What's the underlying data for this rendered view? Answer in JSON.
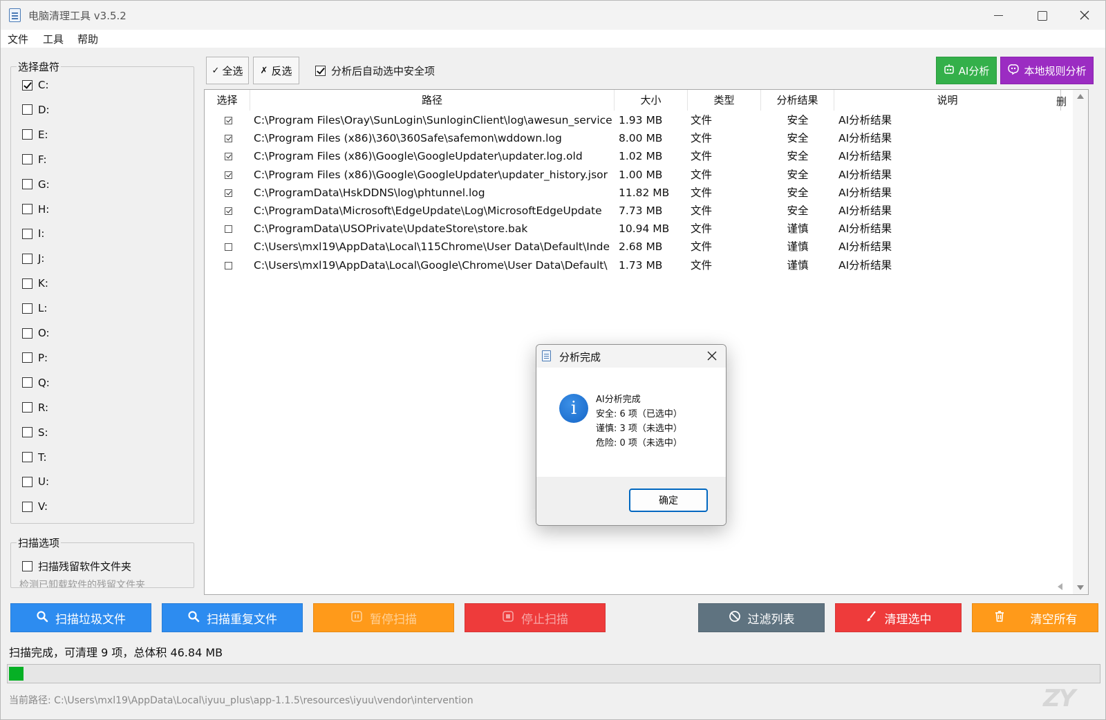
{
  "window": {
    "title": "电脑清理工具 v3.5.2"
  },
  "menu": [
    "文件",
    "工具",
    "帮助"
  ],
  "drive_panel": {
    "title": "选择盘符",
    "drives": [
      {
        "label": "C:",
        "checked": true
      },
      {
        "label": "D:",
        "checked": false
      },
      {
        "label": "E:",
        "checked": false
      },
      {
        "label": "F:",
        "checked": false
      },
      {
        "label": "G:",
        "checked": false
      },
      {
        "label": "H:",
        "checked": false
      },
      {
        "label": "I:",
        "checked": false
      },
      {
        "label": "J:",
        "checked": false
      },
      {
        "label": "K:",
        "checked": false
      },
      {
        "label": "L:",
        "checked": false
      },
      {
        "label": "O:",
        "checked": false
      },
      {
        "label": "P:",
        "checked": false
      },
      {
        "label": "Q:",
        "checked": false
      },
      {
        "label": "R:",
        "checked": false
      },
      {
        "label": "S:",
        "checked": false
      },
      {
        "label": "T:",
        "checked": false
      },
      {
        "label": "U:",
        "checked": false
      },
      {
        "label": "V:",
        "checked": false
      }
    ]
  },
  "scan_options": {
    "title": "扫描选项",
    "leftover_label": "扫描残留软件文件夹",
    "leftover_checked": false,
    "leftover_hint": "检测已卸载软件的残留文件夹"
  },
  "toolbar": {
    "select_all": "全选",
    "select_all_icon": "✓",
    "invert": "反选",
    "invert_icon": "✗",
    "auto_select_label": "分析后自动选中安全项",
    "auto_select_checked": true,
    "ai_button": "AI分析",
    "rule_button": "本地规则分析",
    "ai_color": "#34b04a",
    "rule_color": "#9b2cc2"
  },
  "table": {
    "columns": [
      "选择",
      "路径",
      "大小",
      "类型",
      "分析结果",
      "说明"
    ],
    "overflow_col": "删",
    "rows": [
      {
        "checked": true,
        "path": "C:\\Program Files\\Oray\\SunLogin\\SunloginClient\\log\\awesun_service",
        "size": "1.93 MB",
        "type": "文件",
        "result": "安全",
        "note": "AI分析结果"
      },
      {
        "checked": true,
        "path": "C:\\Program Files (x86)\\360\\360Safe\\safemon\\wddown.log",
        "size": "8.00 MB",
        "type": "文件",
        "result": "安全",
        "note": "AI分析结果"
      },
      {
        "checked": true,
        "path": "C:\\Program Files (x86)\\Google\\GoogleUpdater\\updater.log.old",
        "size": "1.02 MB",
        "type": "文件",
        "result": "安全",
        "note": "AI分析结果"
      },
      {
        "checked": true,
        "path": "C:\\Program Files (x86)\\Google\\GoogleUpdater\\updater_history.jsor",
        "size": "1.00 MB",
        "type": "文件",
        "result": "安全",
        "note": "AI分析结果"
      },
      {
        "checked": true,
        "path": "C:\\ProgramData\\HskDDNS\\log\\phtunnel.log",
        "size": "11.82 MB",
        "type": "文件",
        "result": "安全",
        "note": "AI分析结果"
      },
      {
        "checked": true,
        "path": "C:\\ProgramData\\Microsoft\\EdgeUpdate\\Log\\MicrosoftEdgeUpdate",
        "size": "7.73 MB",
        "type": "文件",
        "result": "安全",
        "note": "AI分析结果"
      },
      {
        "checked": false,
        "path": "C:\\ProgramData\\USOPrivate\\UpdateStore\\store.bak",
        "size": "10.94 MB",
        "type": "文件",
        "result": "谨慎",
        "note": "AI分析结果"
      },
      {
        "checked": false,
        "path": "C:\\Users\\mxl19\\AppData\\Local\\115Chrome\\User Data\\Default\\Inde",
        "size": "2.68 MB",
        "type": "文件",
        "result": "谨慎",
        "note": "AI分析结果"
      },
      {
        "checked": false,
        "path": "C:\\Users\\mxl19\\AppData\\Local\\Google\\Chrome\\User Data\\Default\\",
        "size": "1.73 MB",
        "type": "文件",
        "result": "谨慎",
        "note": "AI分析结果"
      }
    ]
  },
  "buttons": {
    "scan_junk": {
      "label": "扫描垃圾文件",
      "color": "#2d8cf0",
      "icon": "search-icon",
      "enabled": true
    },
    "scan_dup": {
      "label": "扫描重复文件",
      "color": "#2d8cf0",
      "icon": "search-icon",
      "enabled": true
    },
    "pause": {
      "label": "暂停扫描",
      "color": "#ff9a1a",
      "icon": "pause-icon",
      "enabled": false
    },
    "stop": {
      "label": "停止扫描",
      "color": "#ee3b3b",
      "icon": "stop-icon",
      "enabled": false
    },
    "filter": {
      "label": "过滤列表",
      "color": "#5f7380",
      "icon": "ban-icon",
      "enabled": true
    },
    "clean_selected": {
      "label": "清理选中",
      "color": "#ee3b3b",
      "icon": "brush-icon",
      "enabled": true
    },
    "clear_all": {
      "label": "清空所有",
      "color": "#ff9a1a",
      "icon": "trash-icon",
      "enabled": true
    }
  },
  "status": {
    "text": "扫描完成，可清理 9 项，总体积 46.84 MB",
    "progress": 0.013,
    "progress_color": "#06b025",
    "current_path": "当前路径: C:\\Users\\mxl19\\AppData\\Local\\iyuu_plus\\app-1.1.5\\resources\\iyuu\\vendor\\intervention"
  },
  "watermark": "ZY",
  "dialog": {
    "title": "分析完成",
    "lines": [
      "AI分析完成",
      "安全: 6 项（已选中）",
      "谨慎: 3 项（未选中）",
      "危险: 0 项（未选中）"
    ],
    "ok": "确定"
  }
}
